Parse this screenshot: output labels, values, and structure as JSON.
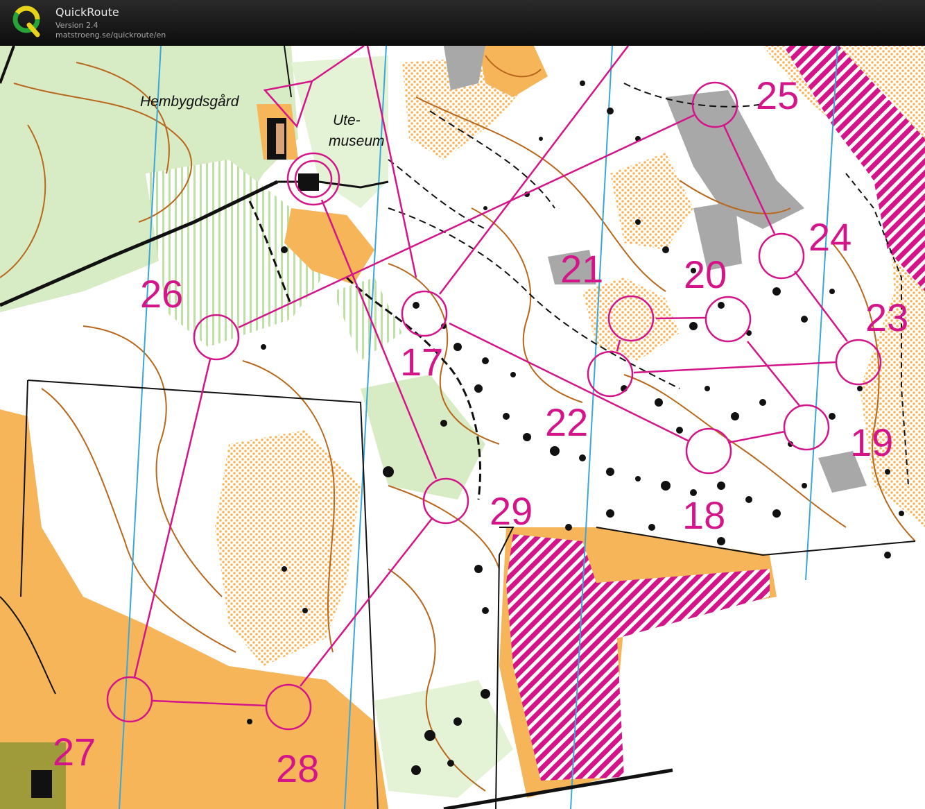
{
  "app": {
    "title": "QuickRoute",
    "version": "Version 2.4",
    "url": "matstroeng.se/quickroute/en"
  },
  "map": {
    "labels": {
      "hembygdsgard": "Hembygdsgård",
      "ute": "Ute-",
      "museum": "museum"
    },
    "controls": [
      {
        "number": "17"
      },
      {
        "number": "18"
      },
      {
        "number": "19"
      },
      {
        "number": "20"
      },
      {
        "number": "21"
      },
      {
        "number": "22"
      },
      {
        "number": "23"
      },
      {
        "number": "24"
      },
      {
        "number": "25"
      },
      {
        "number": "26"
      },
      {
        "number": "27"
      },
      {
        "number": "28"
      },
      {
        "number": "29"
      }
    ],
    "colors": {
      "course": "#d4158a",
      "open_land": "#f7b55a",
      "forest_green": "#cfe8b6",
      "contour": "#b8681c",
      "magnetic_north": "#3aa7d8",
      "olive_area": "#9f9a3a",
      "rock_gray": "#a8a8a8",
      "forbidden_hatch": "#d4158a"
    }
  }
}
